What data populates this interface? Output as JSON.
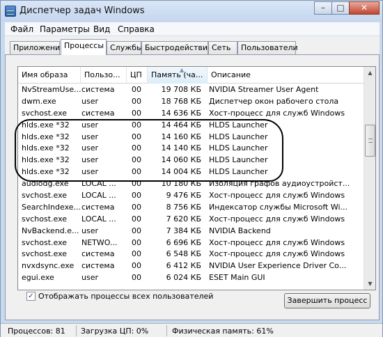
{
  "window": {
    "title": "Диспетчер задач Windows"
  },
  "menu": [
    "Файл",
    "Параметры",
    "Вид",
    "Справка"
  ],
  "tabs": [
    "Приложения",
    "Процессы",
    "Службы",
    "Быстродействие",
    "Сеть",
    "Пользователи"
  ],
  "active_tab": "Процессы",
  "columns": [
    "Имя образа",
    "Пользо...",
    "ЦП",
    "Память (ча...",
    "Описание"
  ],
  "sorted_column": "Память (ча...",
  "processes": [
    [
      "NvStreamUse...",
      "система",
      "00",
      "19 708 КБ",
      "NVIDIA Streamer User Agent"
    ],
    [
      "dwm.exe",
      "user",
      "00",
      "18 768 КБ",
      "Диспетчер окон рабочего стола"
    ],
    [
      "svchost.exe",
      "система",
      "00",
      "14 636 КБ",
      "Хост-процесс для служб Windows"
    ],
    [
      "hlds.exe *32",
      "user",
      "00",
      "14 464 КБ",
      "HLDS Launcher"
    ],
    [
      "hlds.exe *32",
      "user",
      "00",
      "14 160 КБ",
      "HLDS Launcher"
    ],
    [
      "hlds.exe *32",
      "user",
      "00",
      "14 140 КБ",
      "HLDS Launcher"
    ],
    [
      "hlds.exe *32",
      "user",
      "00",
      "14 060 КБ",
      "HLDS Launcher"
    ],
    [
      "hlds.exe *32",
      "user",
      "00",
      "14 004 КБ",
      "HLDS Launcher"
    ],
    [
      "audiodg.exe",
      "LOCAL ...",
      "00",
      "10 180 КБ",
      "Изоляция графов аудиоустройст..."
    ],
    [
      "svchost.exe",
      "LOCAL ...",
      "00",
      "9 476 КБ",
      "Хост-процесс для служб Windows"
    ],
    [
      "SearchIndexe...",
      "система",
      "00",
      "8 756 КБ",
      "Индексатор службы Microsoft Wi..."
    ],
    [
      "svchost.exe",
      "LOCAL ...",
      "00",
      "7 620 КБ",
      "Хост-процесс для служб Windows"
    ],
    [
      "NvBackend.e...",
      "user",
      "00",
      "7 384 КБ",
      "NVIDIA Backend"
    ],
    [
      "svchost.exe",
      "NETWO...",
      "00",
      "6 696 КБ",
      "Хост-процесс для служб Windows"
    ],
    [
      "svchost.exe",
      "система",
      "00",
      "6 548 КБ",
      "Хост-процесс для служб Windows"
    ],
    [
      "nvxdsync.exe",
      "система",
      "00",
      "6 412 КБ",
      "NVIDIA User Experience Driver Co..."
    ],
    [
      "egui.exe",
      "user",
      "00",
      "6 024 КБ",
      "ESET Main GUI"
    ]
  ],
  "show_all_label": "Отображать процессы всех пользователей",
  "show_all_checked": true,
  "end_process_label": "Завершить процесс",
  "status": {
    "processes": "Процессов: 81",
    "cpu": "Загрузка ЦП: 0%",
    "memory": "Физическая память: 61%"
  }
}
